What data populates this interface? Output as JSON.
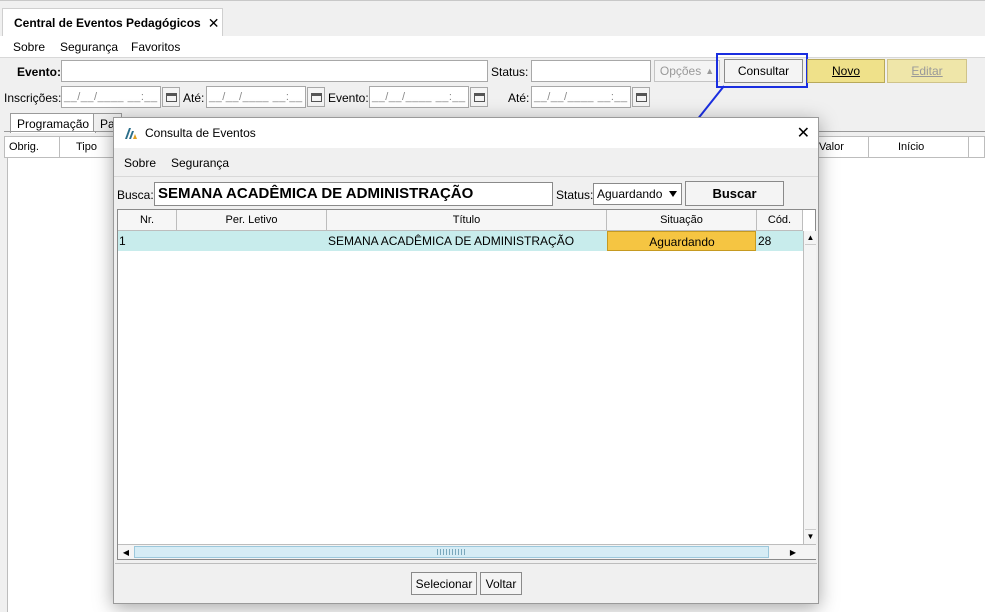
{
  "tab": {
    "title": "Central de Eventos Pedagógicos",
    "close_glyph": "✕"
  },
  "menu": {
    "sobre": "Sobre",
    "seguranca": "Segurança",
    "favoritos": "Favoritos"
  },
  "form": {
    "evento_label": "Evento:",
    "status_label": "Status:",
    "opcoes_label": "Opções",
    "consultar_label": "Consultar",
    "novo_label": "Novo",
    "editar_label": "Editar",
    "inscricoes_label": "Inscrições:",
    "ate_label": "Até:",
    "evento2_label": "Evento:",
    "ate2_label": "Até:",
    "date_mask": "__/__/____ __:__"
  },
  "subtabs": {
    "programacao": "Programação",
    "pa": "Pa"
  },
  "grid": {
    "obrig": "Obrig.",
    "tipo": "Tipo",
    "valor": "Valor",
    "inicio": "Início"
  },
  "modal": {
    "title": "Consulta de Eventos",
    "close_glyph": "✕",
    "menu": {
      "sobre": "Sobre",
      "seguranca": "Segurança"
    },
    "busca_label": "Busca:",
    "busca_value": "SEMANA ACADÊMICA DE ADMINISTRAÇÃO",
    "status_label": "Status:",
    "status_value": "Aguardando",
    "buscar_label": "Buscar",
    "columns": {
      "nr": "Nr.",
      "per": "Per. Letivo",
      "titulo": "Título",
      "situacao": "Situação",
      "cod": "Cód."
    },
    "rows": [
      {
        "nr": "1",
        "per": "",
        "titulo": "SEMANA ACADÊMICA DE ADMINISTRAÇÃO",
        "situacao": "Aguardando",
        "cod": "28"
      }
    ],
    "selecionar_label": "Selecionar",
    "voltar_label": "Voltar"
  },
  "colors": {
    "highlight": "#1a2ee0",
    "row_bg": "#c8ecec",
    "status_bg": "#f5c542",
    "yellow_btn": "#efe18a"
  }
}
